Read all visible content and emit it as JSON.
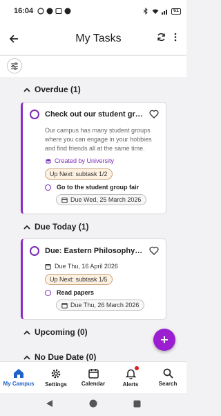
{
  "status_bar": {
    "time": "16:04",
    "battery": "61"
  },
  "app_bar": {
    "title": "My Tasks"
  },
  "sections": {
    "overdue": {
      "label": "Overdue (1)"
    },
    "due_today": {
      "label": "Due Today (1)"
    },
    "upcoming": {
      "label": "Upcoming (0)"
    },
    "no_due_date": {
      "label": "No Due Date (0)"
    }
  },
  "cards": [
    {
      "title": "Check out our student groups!",
      "description": "Our campus has many student groups where you can engage in your hobbies and find friends all at the same time.",
      "creator": "Created by University",
      "badge": "Up Next: subtask 1/2",
      "subtask": "Go to the student group fair",
      "subtask_due": "Due Wed, 25 March 2026"
    },
    {
      "title": "Due: Eastern Philosophy fina...",
      "due": "Due Thu, 16 April 2026",
      "badge": "Up Next: subtask 1/5",
      "subtask": "Read papers",
      "subtask_due": "Due Thu, 26 March 2026"
    }
  ],
  "bottom_nav": [
    {
      "label": "My Campus",
      "icon": "home-icon",
      "active": true
    },
    {
      "label": "Settings",
      "icon": "gear-icon"
    },
    {
      "label": "Calendar",
      "icon": "calendar-icon"
    },
    {
      "label": "Alerts",
      "icon": "bell-icon"
    },
    {
      "label": "Search",
      "icon": "search-icon"
    }
  ],
  "colors": {
    "accent": "#7b2bb5",
    "fab": "#9b1fd1",
    "nav_active": "#1e63c8",
    "alert": "#d82020"
  }
}
